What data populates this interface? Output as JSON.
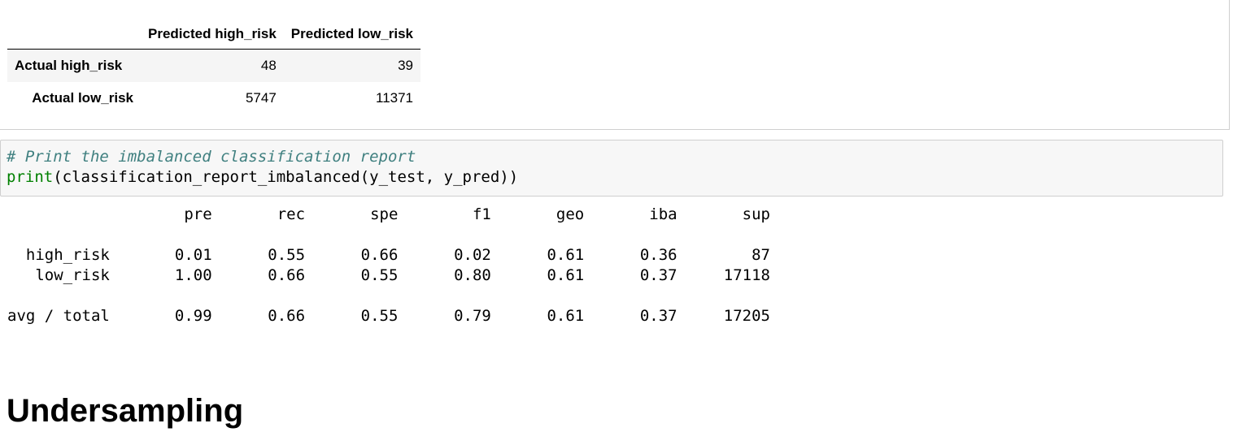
{
  "confusion_matrix": {
    "columns": [
      "Predicted high_risk",
      "Predicted low_risk"
    ],
    "rows": [
      {
        "label": "Actual high_risk",
        "values": [
          "48",
          "39"
        ]
      },
      {
        "label": "Actual low_risk",
        "values": [
          "5747",
          "11371"
        ]
      }
    ]
  },
  "code_cell": {
    "comment": "# Print the imbalanced classification report",
    "builtin": "print",
    "rest": "(classification_report_imbalanced(y_test, y_pred))"
  },
  "report": {
    "lines": [
      "                   pre       rec       spe        f1       geo       iba       sup",
      "",
      "  high_risk       0.01      0.55      0.66      0.02      0.61      0.36        87",
      "   low_risk       1.00      0.66      0.55      0.80      0.61      0.37     17118",
      "",
      "avg / total       0.99      0.66      0.55      0.79      0.61      0.37     17205"
    ]
  },
  "heading": {
    "text": "Undersampling"
  }
}
